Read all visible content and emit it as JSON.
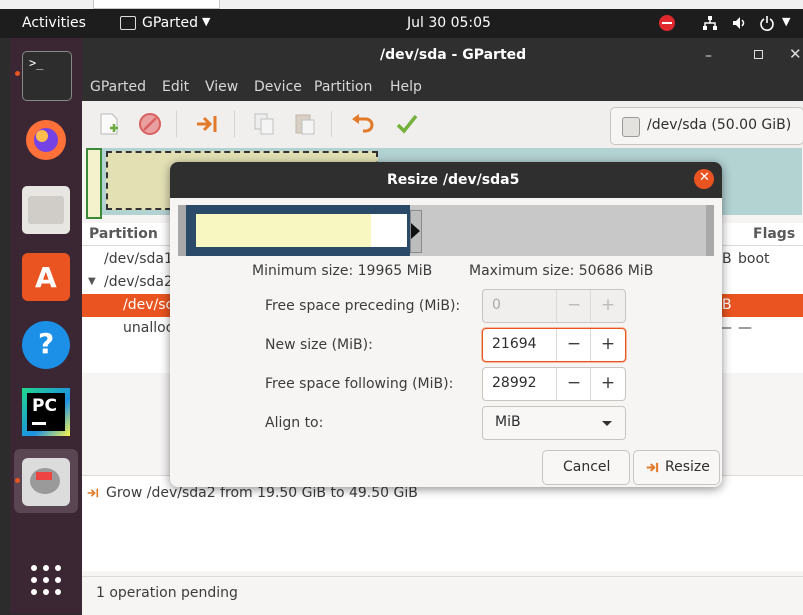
{
  "desktop": {
    "activities": "Activities",
    "app_menu": "GParted",
    "clock": "Jul 30  05:05"
  },
  "window": {
    "title": "/dev/sda - GParted",
    "menu": [
      "GParted",
      "Edit",
      "View",
      "Device",
      "Partition",
      "Help"
    ],
    "device_selector": "/dev/sda (50.00 GiB)"
  },
  "partition_list": {
    "headers": {
      "partition": "Partition",
      "flags": "Flags"
    },
    "rows": [
      {
        "name": "/dev/sda1",
        "size_tail": "B",
        "flags": "boot"
      },
      {
        "name": "/dev/sda2",
        "size_tail": "",
        "flags": ""
      },
      {
        "name": "/dev/sc",
        "size_tail": "B",
        "flags": ""
      },
      {
        "name": "unalloc",
        "size_tail": "—",
        "flags": "—"
      }
    ],
    "selected_index": 2
  },
  "operations": {
    "items": [
      "Grow /dev/sda2 from 19.50 GiB to 49.50 GiB"
    ],
    "status": "1 operation pending"
  },
  "dialog": {
    "title": "Resize /dev/sda5",
    "min_size": "Minimum size: 19965 MiB",
    "max_size": "Maximum size: 50686 MiB",
    "used_fraction": 0.83,
    "partition_fraction": 0.43,
    "fields": {
      "preceding": {
        "label": "Free space preceding (MiB):",
        "value": "0"
      },
      "new_size": {
        "label": "New size (MiB):",
        "value": "21694"
      },
      "following": {
        "label": "Free space following (MiB):",
        "value": "28992"
      },
      "align": {
        "label": "Align to:",
        "value": "MiB"
      }
    },
    "cancel_label": "Cancel",
    "resize_label": "Resize"
  },
  "colors": {
    "accent_orange": "#e95420",
    "partition_border": "#2b4a6a",
    "used_space": "#f8f6c1"
  }
}
